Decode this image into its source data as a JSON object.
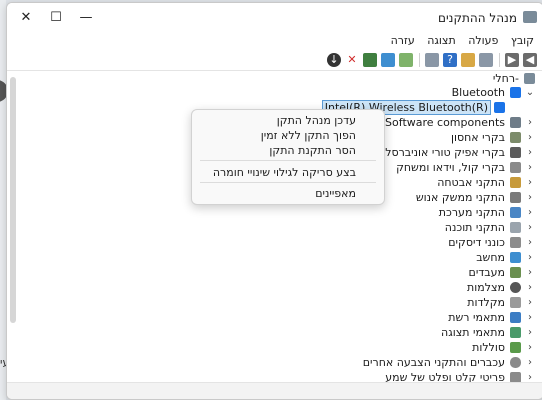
{
  "window": {
    "title": "מנהל ההתקנים"
  },
  "window_controls": {
    "close": "✕",
    "maximize": "☐",
    "minimize": "—"
  },
  "menubar": [
    "קובץ",
    "פעולה",
    "תצוגה",
    "עזרה"
  ],
  "tree": {
    "root": "-רחלי",
    "bluetooth": {
      "label": "Bluetooth",
      "selected_child": "Intel(R) Wireless Bluetooth(R)"
    },
    "categories": [
      "Software components",
      "בקרי אחסון",
      "בקרי אפיק טורי אוניברסליים (USB)",
      "בקרי קול, וידאו ומשחק",
      "התקני אבטחה",
      "התקני ממשק אנוש",
      "התקני מערכת",
      "התקני תוכנה",
      "כונני דיסקים",
      "מחשב",
      "מעבדים",
      "מצלמות",
      "מקלדות",
      "מתאמי רשת",
      "מתאמי תצוגה",
      "סוללות",
      "עכברים והתקני הצבעה אחרים",
      "פריטי קלט ופלט של שמע"
    ]
  },
  "context_menu": {
    "items": [
      "עדכן מנהל התקן",
      "הפוך התקן ללא זמין",
      "הסר התקנת התקן"
    ],
    "scan": "בצע סריקה לגילוי שינויי חומרה",
    "properties": "מאפיינים"
  },
  "background": {
    "left_text": "עי"
  },
  "colors": {
    "selection_bg": "#cce4f7",
    "selection_border": "#5b9bd5",
    "bluetooth_icon": "#1a73e8"
  }
}
